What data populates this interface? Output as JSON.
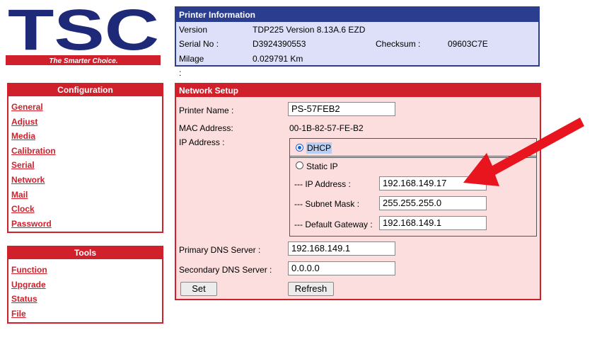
{
  "logo": {
    "brand": "TSC",
    "tagline": "The Smarter Choice."
  },
  "printer_info": {
    "title": "Printer Information",
    "version_label": "Version :",
    "version_value": "TDP225 Version 8.13A.6 EZD",
    "serial_label": "Serial No :",
    "serial_value": "D3924390553",
    "checksum_label": "Checksum :",
    "checksum_value": "09603C7E",
    "milage_label": "Milage :",
    "milage_value": "0.029791 Km"
  },
  "configuration": {
    "title": "Configuration",
    "items": [
      "General",
      "Adjust",
      "Media",
      "Calibration",
      "Serial",
      "Network",
      "Mail",
      "Clock",
      "Password"
    ]
  },
  "tools": {
    "title": "Tools",
    "items": [
      "Function",
      "Upgrade",
      "Status",
      "File"
    ]
  },
  "network": {
    "title": "Network Setup",
    "printer_name_label": "Printer Name :",
    "printer_name_value": "PS-57FEB2",
    "mac_label": "MAC Address:",
    "mac_value": "00-1B-82-57-FE-B2",
    "ip_label": "IP Address :",
    "dhcp_label": "DHCP",
    "static_label": "Static IP",
    "static_ip_label": "--- IP Address :",
    "static_ip_value": "192.168.149.17",
    "subnet_label": "--- Subnet Mask :",
    "subnet_value": "255.255.255.0",
    "gateway_label": "--- Default Gateway :",
    "gateway_value": "192.168.149.1",
    "primary_dns_label": "Primary DNS Server :",
    "primary_dns_value": "192.168.149.1",
    "secondary_dns_label": "Secondary DNS Server :",
    "secondary_dns_value": "0.0.0.0",
    "set_button": "Set",
    "refresh_button": "Refresh"
  },
  "colors": {
    "accent_red": "#d0202c",
    "navy": "#2a3d8f",
    "arrow": "#e8141e"
  }
}
